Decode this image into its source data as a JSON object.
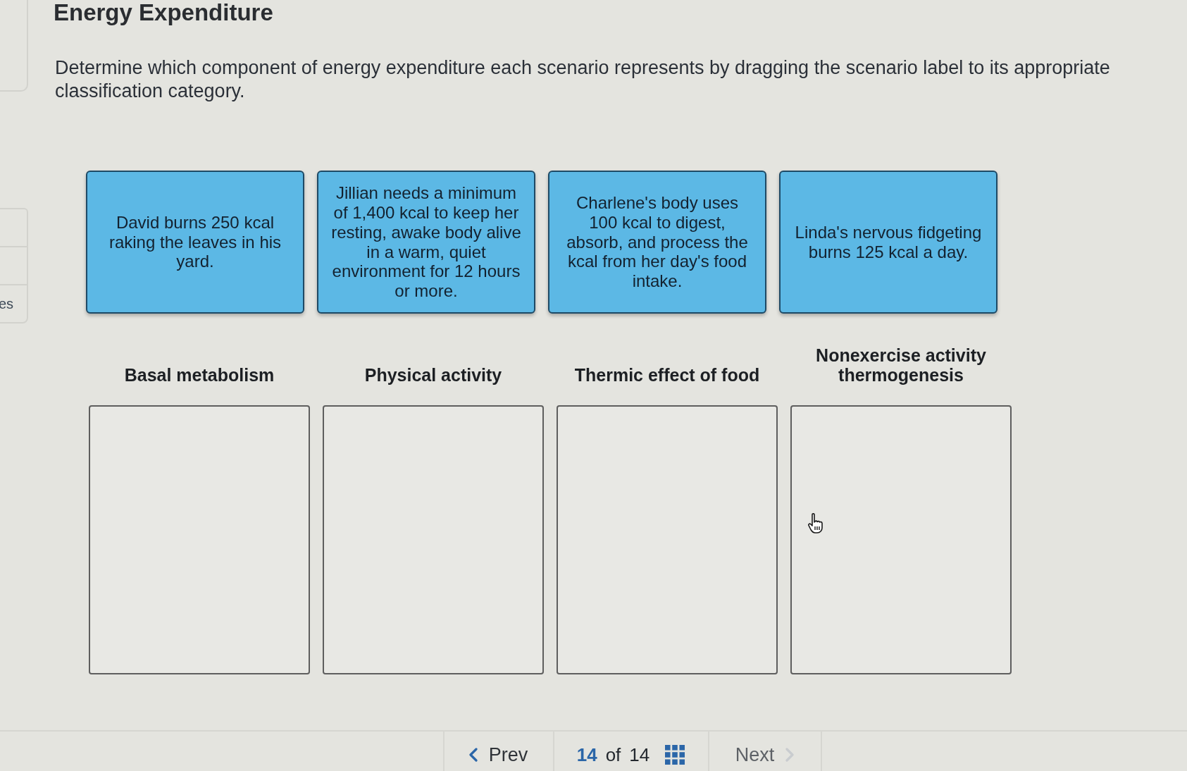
{
  "title": "Energy Expenditure",
  "instruction": "Determine which component of energy expenditure each scenario represents by dragging the scenario label to its appropriate classification category.",
  "side_panel": {
    "items": [
      {
        "label": "es"
      }
    ]
  },
  "scenario_labels": [
    {
      "text": "David burns 250 kcal raking the leaves in his yard."
    },
    {
      "text": "Jillian needs a minimum of 1,400 kcal to keep her resting, awake body alive in a warm, quiet environment for 12 hours or more."
    },
    {
      "text": "Charlene's body uses 100 kcal to digest, absorb, and process the kcal from her day's food intake."
    },
    {
      "text": "Linda's nervous fidgeting burns 125 kcal a day."
    }
  ],
  "categories": [
    {
      "heading": "Basal metabolism"
    },
    {
      "heading": "Physical activity"
    },
    {
      "heading": "Thermic effect of food"
    },
    {
      "heading": "Nonexercise activity thermogenesis"
    }
  ],
  "pagination": {
    "prev": {
      "label": "Prev",
      "disabled": false
    },
    "current": "14",
    "of_text": "of",
    "total": "14",
    "next": {
      "label": "Next",
      "disabled": true
    }
  }
}
